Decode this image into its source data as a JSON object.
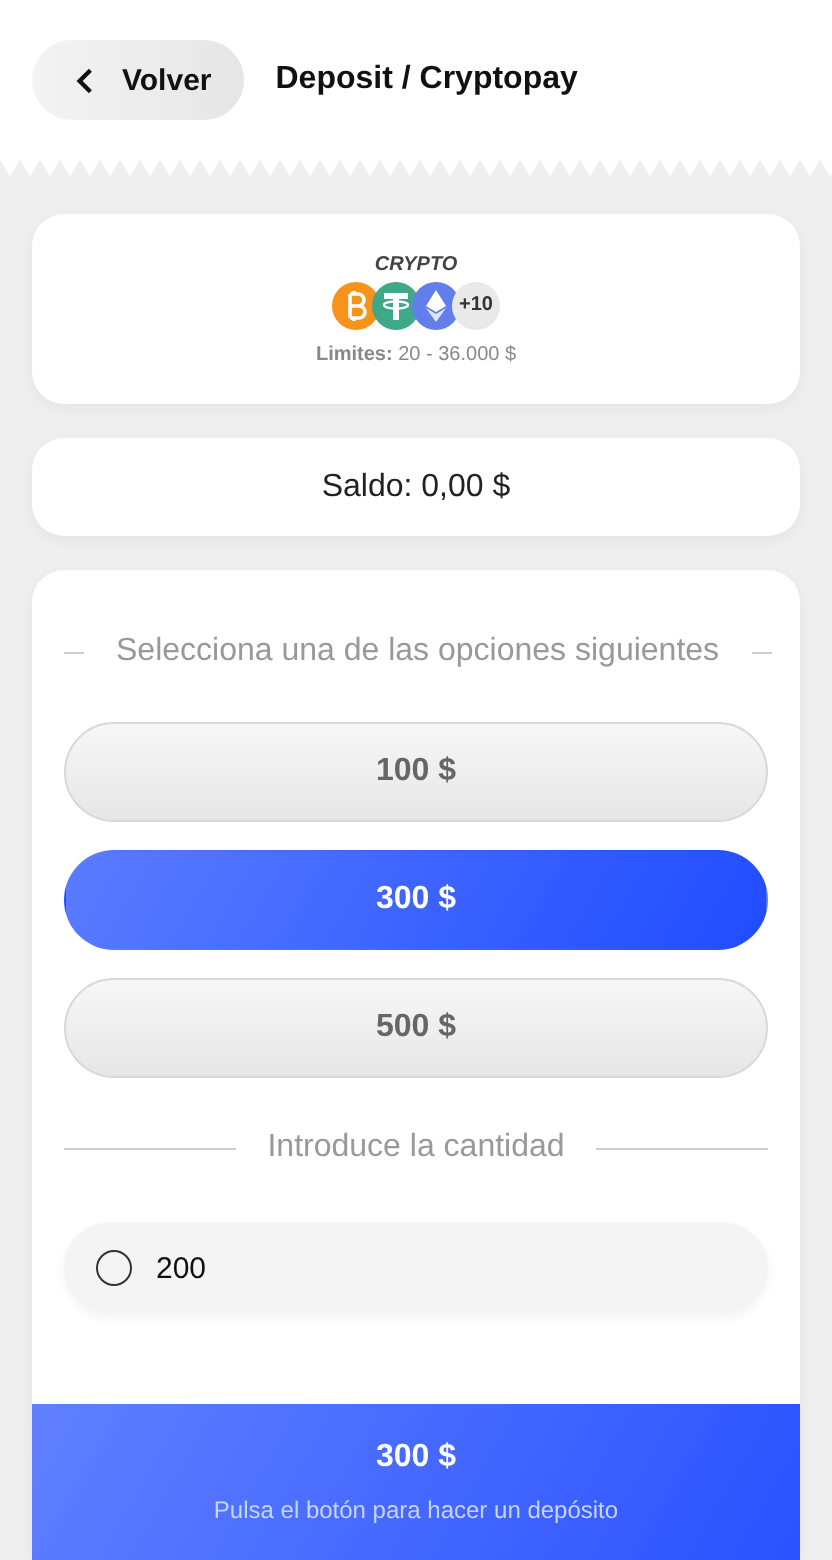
{
  "header": {
    "back_button": "Volver",
    "title": "Deposit / Cryptopay"
  },
  "method": {
    "name": "CRYPTO",
    "more_count": "+10",
    "limits": "**Limites:** 20 - 36.000 $"
  },
  "balance": "Saldo: 0,00 $",
  "options_heading": "Selecciona una de las opciones siguientes",
  "options": [
    {
      "label": "100 $",
      "selected": false
    },
    {
      "label": "300 $",
      "selected": true
    },
    {
      "label": "500 $",
      "selected": false
    }
  ],
  "amount_heading": "Introduce la cantidad",
  "amount_field": {
    "value": "200",
    "checked": false
  },
  "deposit_button": {
    "amount": "300 $",
    "hint": "Pulsa el botón para hacer un depósito"
  }
}
